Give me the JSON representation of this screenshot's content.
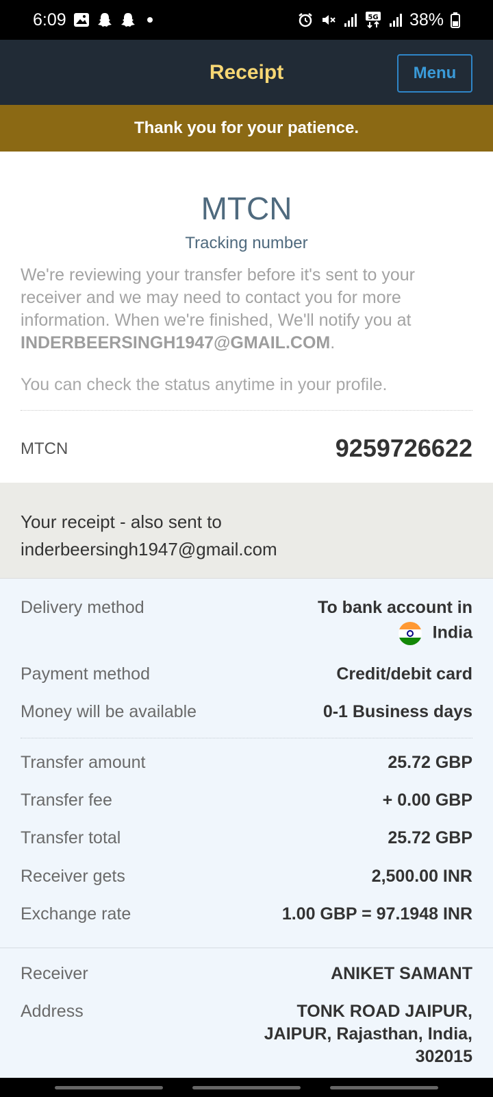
{
  "status_bar": {
    "time": "6:09",
    "battery": "38%",
    "left_icons": [
      "gallery-icon",
      "snapchat-icon",
      "snapchat-icon",
      "dot-icon"
    ],
    "right_icons": [
      "alarm-icon",
      "mute-icon",
      "signal-icon",
      "5g-icon",
      "signal-icon",
      "battery-icon"
    ]
  },
  "header": {
    "title": "Receipt",
    "menu_label": "Menu",
    "title_color": "#f7d774",
    "bg_color": "#212b36"
  },
  "banner": {
    "text": "Thank you for your patience.",
    "bg_color": "#8b6914"
  },
  "intro": {
    "heading": "MTCN",
    "subheading": "Tracking number",
    "review_text": "We're reviewing your transfer before it's sent to your receiver and we may need to contact you for more information. When we're finished, We'll notify you at ",
    "email": "INDERBEERSINGH1947@GMAIL.COM",
    "email_suffix": ".",
    "status_text": "You can check the status anytime in your profile.",
    "mtcn_label": "MTCN",
    "mtcn_value": "9259726622"
  },
  "receipt": {
    "line1": "Your receipt - also sent to",
    "line2": "inderbeersingh1947@gmail.com"
  },
  "details": {
    "delivery_method_label": "Delivery method",
    "delivery_method_value_line1": "To bank account in",
    "delivery_method_value_line2": "India",
    "payment_method_label": "Payment method",
    "payment_method_value": "Credit/debit card",
    "availability_label": "Money will be available",
    "availability_value": "0-1 Business days",
    "transfer_amount_label": "Transfer amount",
    "transfer_amount_value": "25.72 GBP",
    "transfer_fee_label": "Transfer fee",
    "transfer_fee_value": "+ 0.00 GBP",
    "transfer_total_label": "Transfer total",
    "transfer_total_value": "25.72 GBP",
    "receiver_gets_label": "Receiver gets",
    "receiver_gets_value": "2,500.00 INR",
    "exchange_rate_label": "Exchange rate",
    "exchange_rate_value": "1.00 GBP = 97.1948 INR",
    "receiver_label": "Receiver",
    "receiver_value": "ANIKET SAMANT",
    "address_label": "Address",
    "address_line1": "TONK ROAD JAIPUR,",
    "address_line2": "JAIPUR, Rajasthan, India,",
    "address_line3": "302015"
  }
}
